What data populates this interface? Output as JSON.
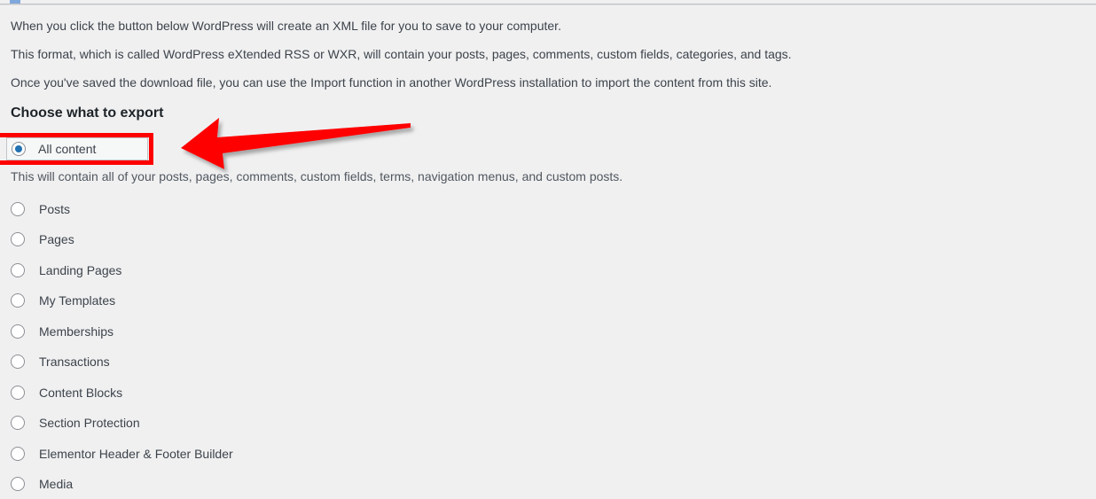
{
  "page": {
    "background_color": "#f0f0f1",
    "text_color": "#3c434a"
  },
  "paragraphs": [
    "When you click the button below WordPress will create an XML file for you to save to your computer.",
    "This format, which is called WordPress eXtended RSS or WXR, will contain your posts, pages, comments, custom fields, categories, and tags.",
    "Once you've saved the download file, you can use the Import function in another WordPress installation to import the content from this site."
  ],
  "section": {
    "heading": "Choose what to export",
    "selected_option": {
      "label": "All content",
      "checked": true,
      "description": "This will contain all of your posts, pages, comments, custom fields, terms, navigation menus, and custom posts."
    },
    "options": [
      {
        "label": "Posts",
        "checked": false
      },
      {
        "label": "Pages",
        "checked": false
      },
      {
        "label": "Landing Pages",
        "checked": false
      },
      {
        "label": "My Templates",
        "checked": false
      },
      {
        "label": "Memberships",
        "checked": false
      },
      {
        "label": "Transactions",
        "checked": false
      },
      {
        "label": "Content Blocks",
        "checked": false
      },
      {
        "label": "Section Protection",
        "checked": false
      },
      {
        "label": "Elementor Header & Footer Builder",
        "checked": false
      },
      {
        "label": "Media",
        "checked": false
      }
    ]
  },
  "annotations": {
    "highlight_color": "#fe0000",
    "arrow_color": "#fe0000",
    "arrow_direction": "left",
    "highlight_target": "All content"
  }
}
